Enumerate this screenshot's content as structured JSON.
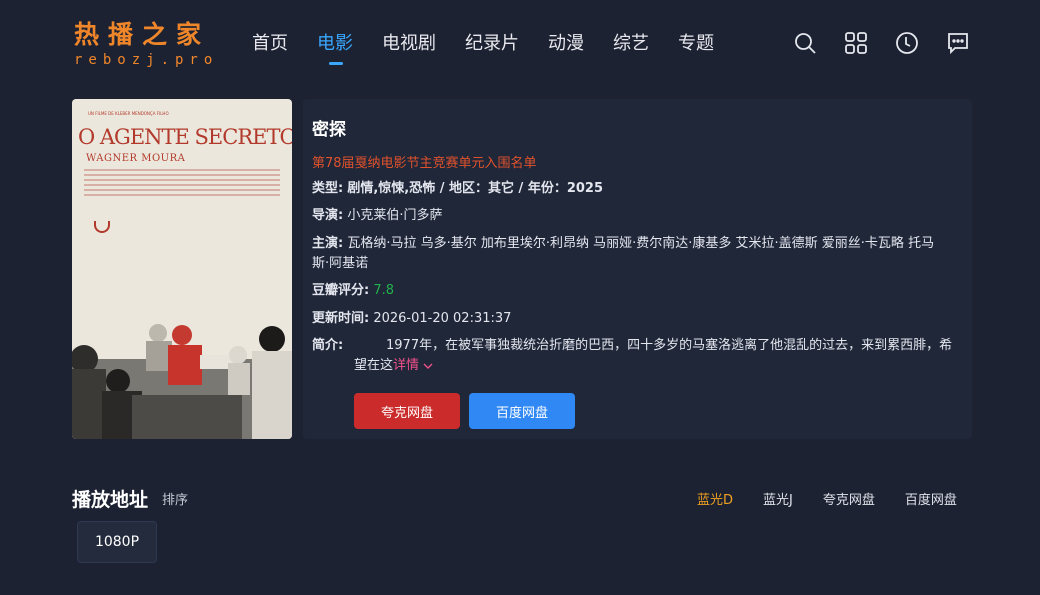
{
  "logo": {
    "title": "热播之家",
    "subtitle": "rebozj.pro"
  },
  "nav": [
    {
      "label": "首页",
      "active": false
    },
    {
      "label": "电影",
      "active": true
    },
    {
      "label": "电视剧",
      "active": false
    },
    {
      "label": "纪录片",
      "active": false
    },
    {
      "label": "动漫",
      "active": false
    },
    {
      "label": "综艺",
      "active": false
    },
    {
      "label": "专题",
      "active": false
    }
  ],
  "header_icons": [
    "search-icon",
    "grid-icon",
    "history-icon",
    "message-icon"
  ],
  "poster": {
    "small_text": "UN FILME DE KLEBER MENDONÇA FILHO",
    "title": "O AGENTE SECRETO",
    "subtitle": "WAGNER MOURA",
    "festival": "FESTIVAL DE CANNES"
  },
  "movie": {
    "title": "密探",
    "festival": "第78届戛纳电影节主竞赛单元入围名单",
    "type_label": "类型:",
    "type_value": "剧情,惊悚,恐怖 / 地区：其它 / 年份：2025",
    "director_label": "导演:",
    "director_value": "小克莱伯·门多萨",
    "cast_label": "主演:",
    "cast_value": "瓦格纳·马拉 乌多·基尔 加布里埃尔·利昂纳 马丽娅·费尔南达·康基多 艾米拉·盖德斯 爱丽丝·卡瓦略 托马斯·阿基诺",
    "score_label": "豆瓣评分:",
    "score_value": "7.8",
    "time_label": "更新时间:",
    "time_value": "2026-01-20 02:31:37",
    "intro_label": "简介:",
    "intro_text": "1977年，在被军事独裁统治折磨的巴西，四十多岁的马塞洛逃离了他混乱的过去，来到累西腓，希望在这",
    "more_label": "详情 ",
    "more_icon": "chevron-down-icon"
  },
  "buttons": {
    "quark": "夸克网盘",
    "baidu": "百度网盘"
  },
  "play": {
    "title": "播放地址",
    "sort_label": "排序",
    "sources": [
      {
        "label": "蓝光D",
        "active": true
      },
      {
        "label": "蓝光J",
        "active": false
      },
      {
        "label": "夸克网盘",
        "active": false
      },
      {
        "label": "百度网盘",
        "active": false
      }
    ],
    "episodes": [
      "1080P"
    ]
  },
  "colors": {
    "background": "#1c2232",
    "accent": "#3aa7ff",
    "logo": "#f0862a",
    "festival": "#e0522c",
    "score": "#22b14c",
    "quark": "#cb2b2b",
    "baidu": "#3088f5",
    "source_active": "#f0a020"
  }
}
